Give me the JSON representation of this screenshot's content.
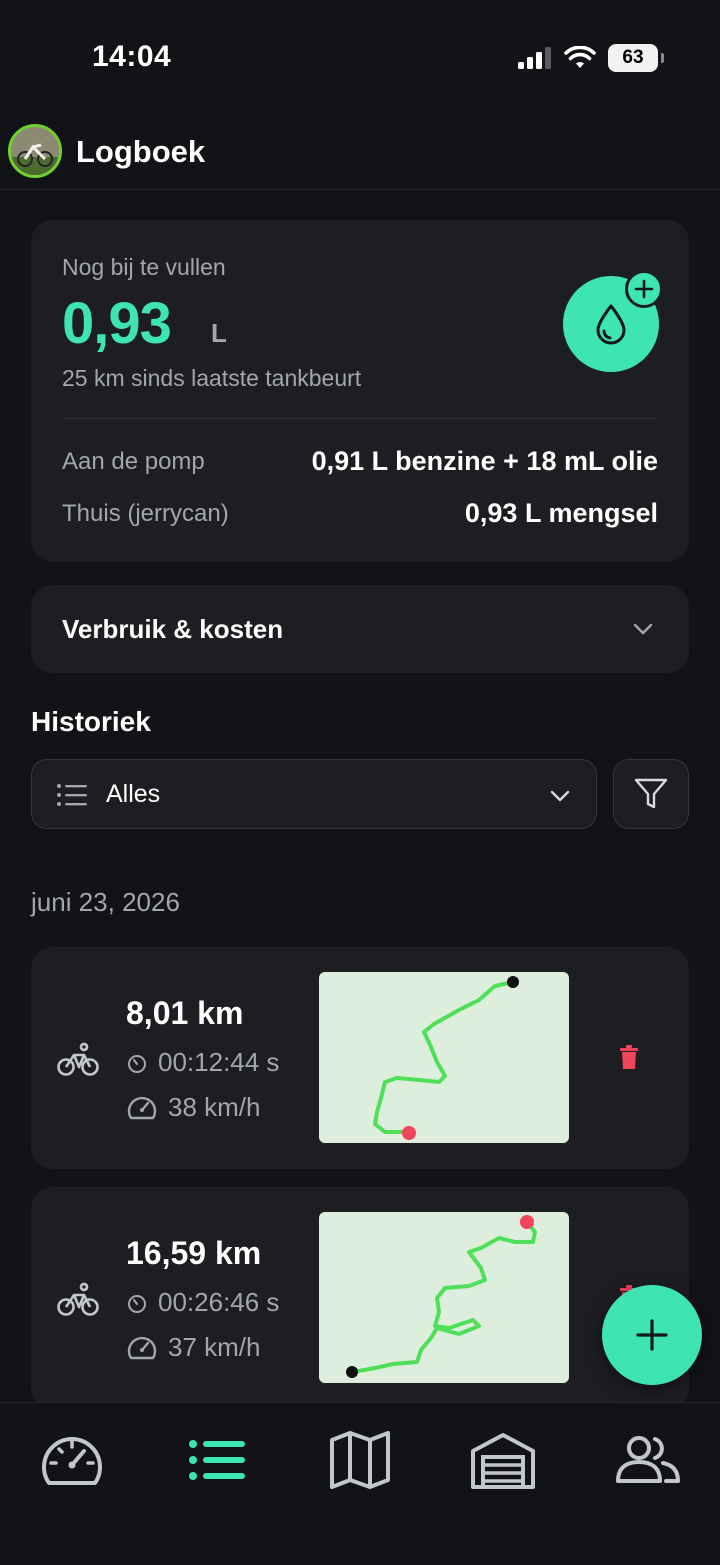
{
  "status_bar": {
    "time": "14:04",
    "battery": "63"
  },
  "header": {
    "title": "Logboek",
    "avatar": "bike-photo-avatar"
  },
  "fuel": {
    "caption": "Nog bij te vullen",
    "value": "0,93",
    "unit": "L",
    "subtitle": "25 km sinds laatste tankbeurt",
    "rows": [
      {
        "label": "Aan de pomp",
        "value": "0,91 L benzine + 18 mL olie"
      },
      {
        "label": "Thuis (jerrycan)",
        "value": "0,93 L mengsel"
      }
    ]
  },
  "consumption": {
    "label": "Verbruik & kosten"
  },
  "history": {
    "title": "Historiek",
    "filter_value": "Alles"
  },
  "date_group": "juni 23, 2026",
  "trips": [
    {
      "distance": "8,01 km",
      "duration": "00:12:44 s",
      "speed": "38 km/h"
    },
    {
      "distance": "16,59 km",
      "duration": "00:26:46 s",
      "speed": "37 km/h"
    }
  ],
  "colors": {
    "accent": "#3ee5b3",
    "background": "#121316",
    "card": "#1d1e22",
    "route": "#4fe05a",
    "delete": "#f2455a",
    "map": "#deeedd"
  },
  "tabs": [
    "speedometer-icon",
    "list-icon",
    "map-icon",
    "garage-icon",
    "users-icon"
  ],
  "active_tab": "list-icon"
}
